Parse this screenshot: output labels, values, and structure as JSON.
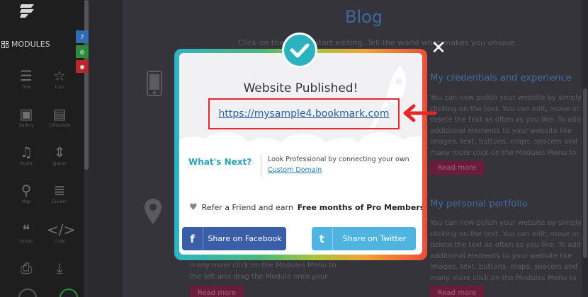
{
  "sidebar": {
    "title": "MODULES",
    "modules": [
      {
        "label": "Title",
        "icon": "title-icon"
      },
      {
        "label": "Icon",
        "icon": "star-icon"
      },
      {
        "label": "Gallery",
        "icon": "gallery-icon"
      },
      {
        "label": "Slideshow",
        "icon": "slideshow-icon"
      },
      {
        "label": "Audio",
        "icon": "music-icon"
      },
      {
        "label": "Spacer",
        "icon": "spacer-icon"
      },
      {
        "label": "Map",
        "icon": "map-pin-icon"
      },
      {
        "label": "Divider",
        "icon": "divider-icon"
      },
      {
        "label": "Quote",
        "icon": "quote-icon"
      },
      {
        "label": "Code",
        "icon": "code-icon"
      },
      {
        "label": "",
        "icon": "print-icon"
      },
      {
        "label": "",
        "icon": "download-icon"
      }
    ],
    "tools": [
      {
        "icon": "help-icon",
        "color": "#2f6db5"
      },
      {
        "icon": "settings-icon",
        "color": "#2e8b3c"
      },
      {
        "icon": "record-icon",
        "color": "#b8282e"
      }
    ]
  },
  "page": {
    "blog_title": "Blog",
    "subtitle": "Click on the text to start editing. Tell the world what makes you unique.",
    "section1_heading": "My credentials and experience",
    "section1_text": "You can now polish your website by simply clicking on the text. You can edit, move or delete the text as often as you like. To add additional elements to your website like images, text, buttons, maps, spacers and many more click on the Modules Menu to the left and drag the Module onto your page.",
    "section2_heading": "My personal portfolio",
    "section2_text": "You can now polish your website by simply clicking on the text. You can edit, move or delete the text as often as you like. To add additional elements to your website like images, text, buttons, maps, spacers and many more click on the Modules Menu to the left and drag the Module onto your page.",
    "left_text": "many more click on the Modules Menu to the left and drag the Module onto your page.",
    "read_more": "Read more"
  },
  "modal": {
    "title": "Website Published!",
    "url": "https://mysample4.bookmark.com",
    "whats_next": "What's Next?",
    "look_professional": "Look Professional by connecting your own",
    "custom_domain": "Custom Domain",
    "refer_prefix": "Refer a Friend and earn",
    "refer_bold": "Free months of Pro Membership",
    "facebook_button": "Share on Facebook",
    "twitter_button": "Share on Twitter",
    "close_symbol": "✕"
  },
  "colors": {
    "accent_teal": "#2ab3bf",
    "highlight_red": "#e0282e",
    "facebook_blue": "#3b5ea8",
    "twitter_blue": "#4fb5e0"
  }
}
